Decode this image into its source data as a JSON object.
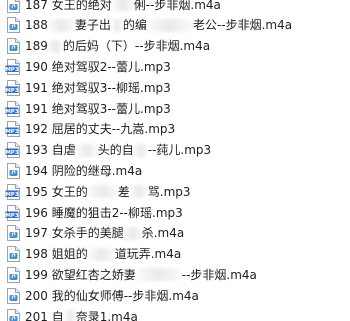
{
  "mp3_icon_label": "MP3",
  "files": [
    {
      "icon": "m4a-file-icon",
      "parts": [
        "187 女王的绝对",
        "俐--步非烟.m4a"
      ]
    },
    {
      "icon": "m4a-file-icon",
      "parts": [
        "188",
        "妻子出",
        "的编",
        "老公--步非烟.m4a"
      ]
    },
    {
      "icon": "m4a-file-icon",
      "parts": [
        "189",
        "的后妈（下）--步非烟.m4a"
      ]
    },
    {
      "icon": "mp3-file-icon",
      "parts": [
        "190 绝对驾驭2--蕾儿.mp3"
      ]
    },
    {
      "icon": "mp3-file-icon",
      "parts": [
        "191 绝对驾驭3--柳瑶.mp3"
      ]
    },
    {
      "icon": "mp3-file-icon",
      "parts": [
        "191 绝对驾驭3--蕾儿.mp3"
      ]
    },
    {
      "icon": "mp3-file-icon",
      "parts": [
        "192 屈居的丈夫--九嵩.mp3"
      ]
    },
    {
      "icon": "mp3-file-icon",
      "parts": [
        "193 自虐",
        "头的自",
        "--莼儿.mp3"
      ]
    },
    {
      "icon": "m4a-file-icon",
      "parts": [
        "194 阴险的继母.m4a"
      ]
    },
    {
      "icon": "mp3-file-icon",
      "parts": [
        "195 女王的",
        "差",
        "骂.mp3"
      ]
    },
    {
      "icon": "mp3-file-icon",
      "parts": [
        "196 睡魔的狙击2--柳瑶.mp3"
      ]
    },
    {
      "icon": "m4a-file-icon",
      "parts": [
        "197 女杀手的美腿",
        "杀.m4a"
      ]
    },
    {
      "icon": "m4a-file-icon",
      "parts": [
        "198 姐姐的",
        "道玩弄.m4a"
      ]
    },
    {
      "icon": "m4a-file-icon",
      "parts": [
        "199 欲望红杏之娇妻",
        "--步非烟.m4a"
      ]
    },
    {
      "icon": "m4a-file-icon",
      "parts": [
        "200 我的仙女师傅--步非烟.m4a"
      ]
    },
    {
      "icon": "m4a-file-icon",
      "parts": [
        "201 自",
        "奈录1.m4a"
      ]
    }
  ]
}
